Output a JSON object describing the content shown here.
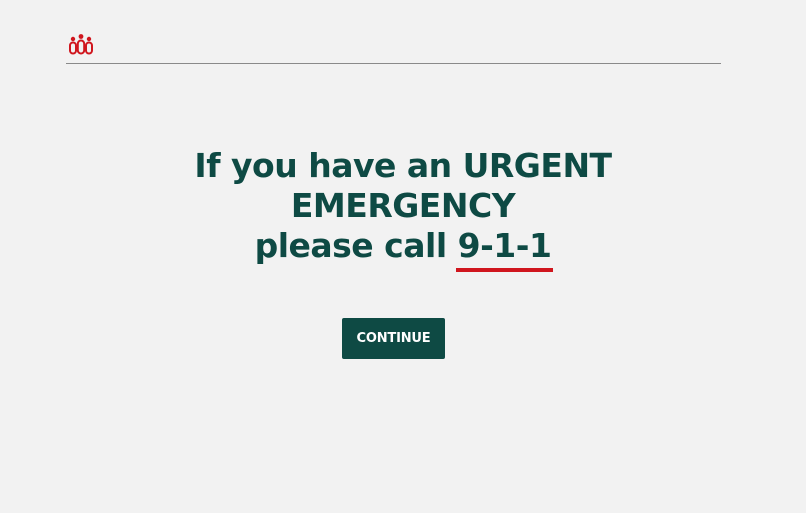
{
  "header": {
    "logo_icon": "people-group-icon",
    "logo_color": "#d0161e"
  },
  "message": {
    "line1": "If you have an URGENT",
    "line2": "EMERGENCY",
    "line3_prefix": "please call ",
    "emergency_number": "9-1-1"
  },
  "actions": {
    "continue_label": "CONTINUE"
  },
  "colors": {
    "primary": "#0e4a44",
    "accent": "#d0161e",
    "background": "#f2f2f2"
  }
}
